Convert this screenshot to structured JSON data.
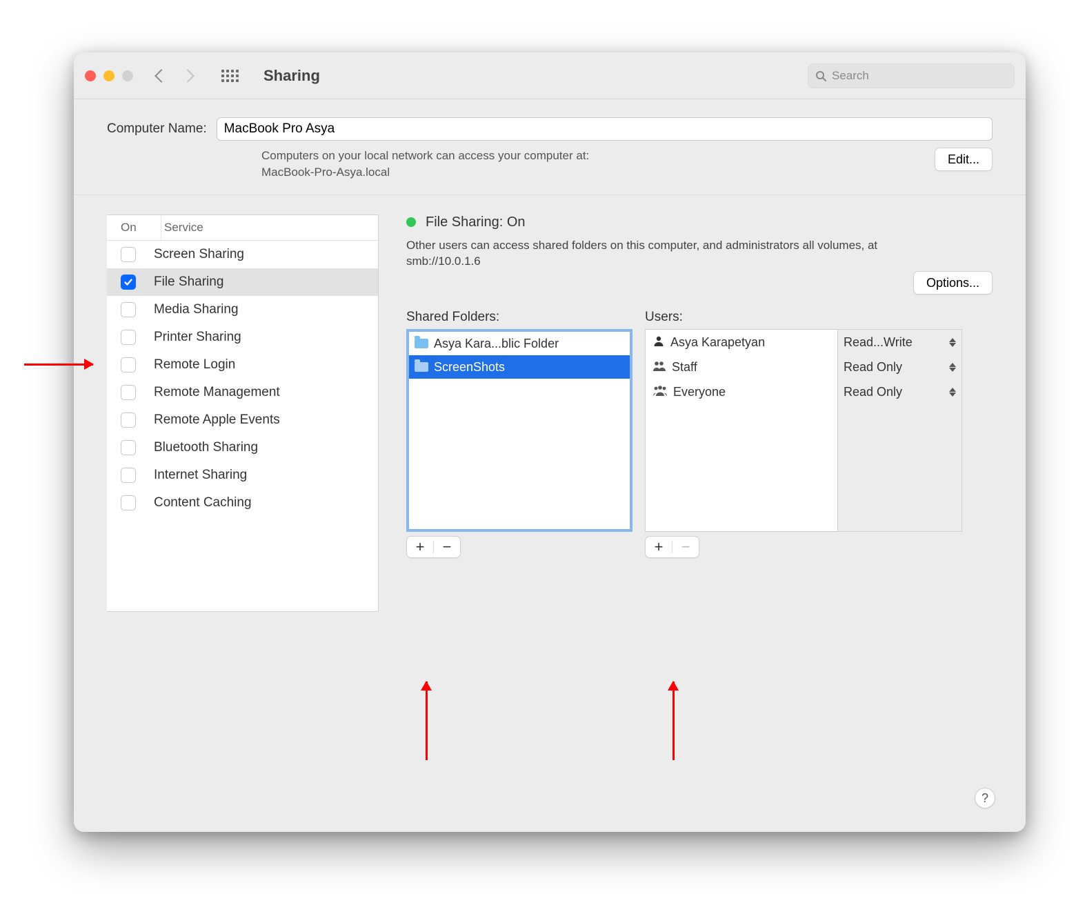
{
  "toolbar": {
    "title": "Sharing",
    "search_placeholder": "Search"
  },
  "header": {
    "computer_name_label": "Computer Name:",
    "computer_name_value": "MacBook Pro Asya",
    "hint_line1": "Computers on your local network can access your computer at:",
    "hint_line2": "MacBook-Pro-Asya.local",
    "edit_label": "Edit..."
  },
  "sidebar": {
    "col_on": "On",
    "col_service": "Service",
    "items": [
      {
        "label": "Screen Sharing",
        "on": false,
        "selected": false
      },
      {
        "label": "File Sharing",
        "on": true,
        "selected": true
      },
      {
        "label": "Media Sharing",
        "on": false,
        "selected": false
      },
      {
        "label": "Printer Sharing",
        "on": false,
        "selected": false
      },
      {
        "label": "Remote Login",
        "on": false,
        "selected": false
      },
      {
        "label": "Remote Management",
        "on": false,
        "selected": false
      },
      {
        "label": "Remote Apple Events",
        "on": false,
        "selected": false
      },
      {
        "label": "Bluetooth Sharing",
        "on": false,
        "selected": false
      },
      {
        "label": "Internet Sharing",
        "on": false,
        "selected": false
      },
      {
        "label": "Content Caching",
        "on": false,
        "selected": false
      }
    ]
  },
  "right": {
    "status_label": "File Sharing: On",
    "desc": "Other users can access shared folders on this computer, and administrators all volumes, at smb://10.0.1.6",
    "options_label": "Options...",
    "shared_folders_label": "Shared Folders:",
    "folders": [
      {
        "label": "Asya Kara...blic Folder",
        "selected": false
      },
      {
        "label": "ScreenShots",
        "selected": true
      }
    ],
    "users_label": "Users:",
    "users": [
      {
        "label": "Asya Karapetyan",
        "icon": "person"
      },
      {
        "label": "Staff",
        "icon": "pair"
      },
      {
        "label": "Everyone",
        "icon": "group"
      }
    ],
    "perms": [
      {
        "label": "Read...Write"
      },
      {
        "label": "Read Only"
      },
      {
        "label": "Read Only"
      }
    ]
  }
}
